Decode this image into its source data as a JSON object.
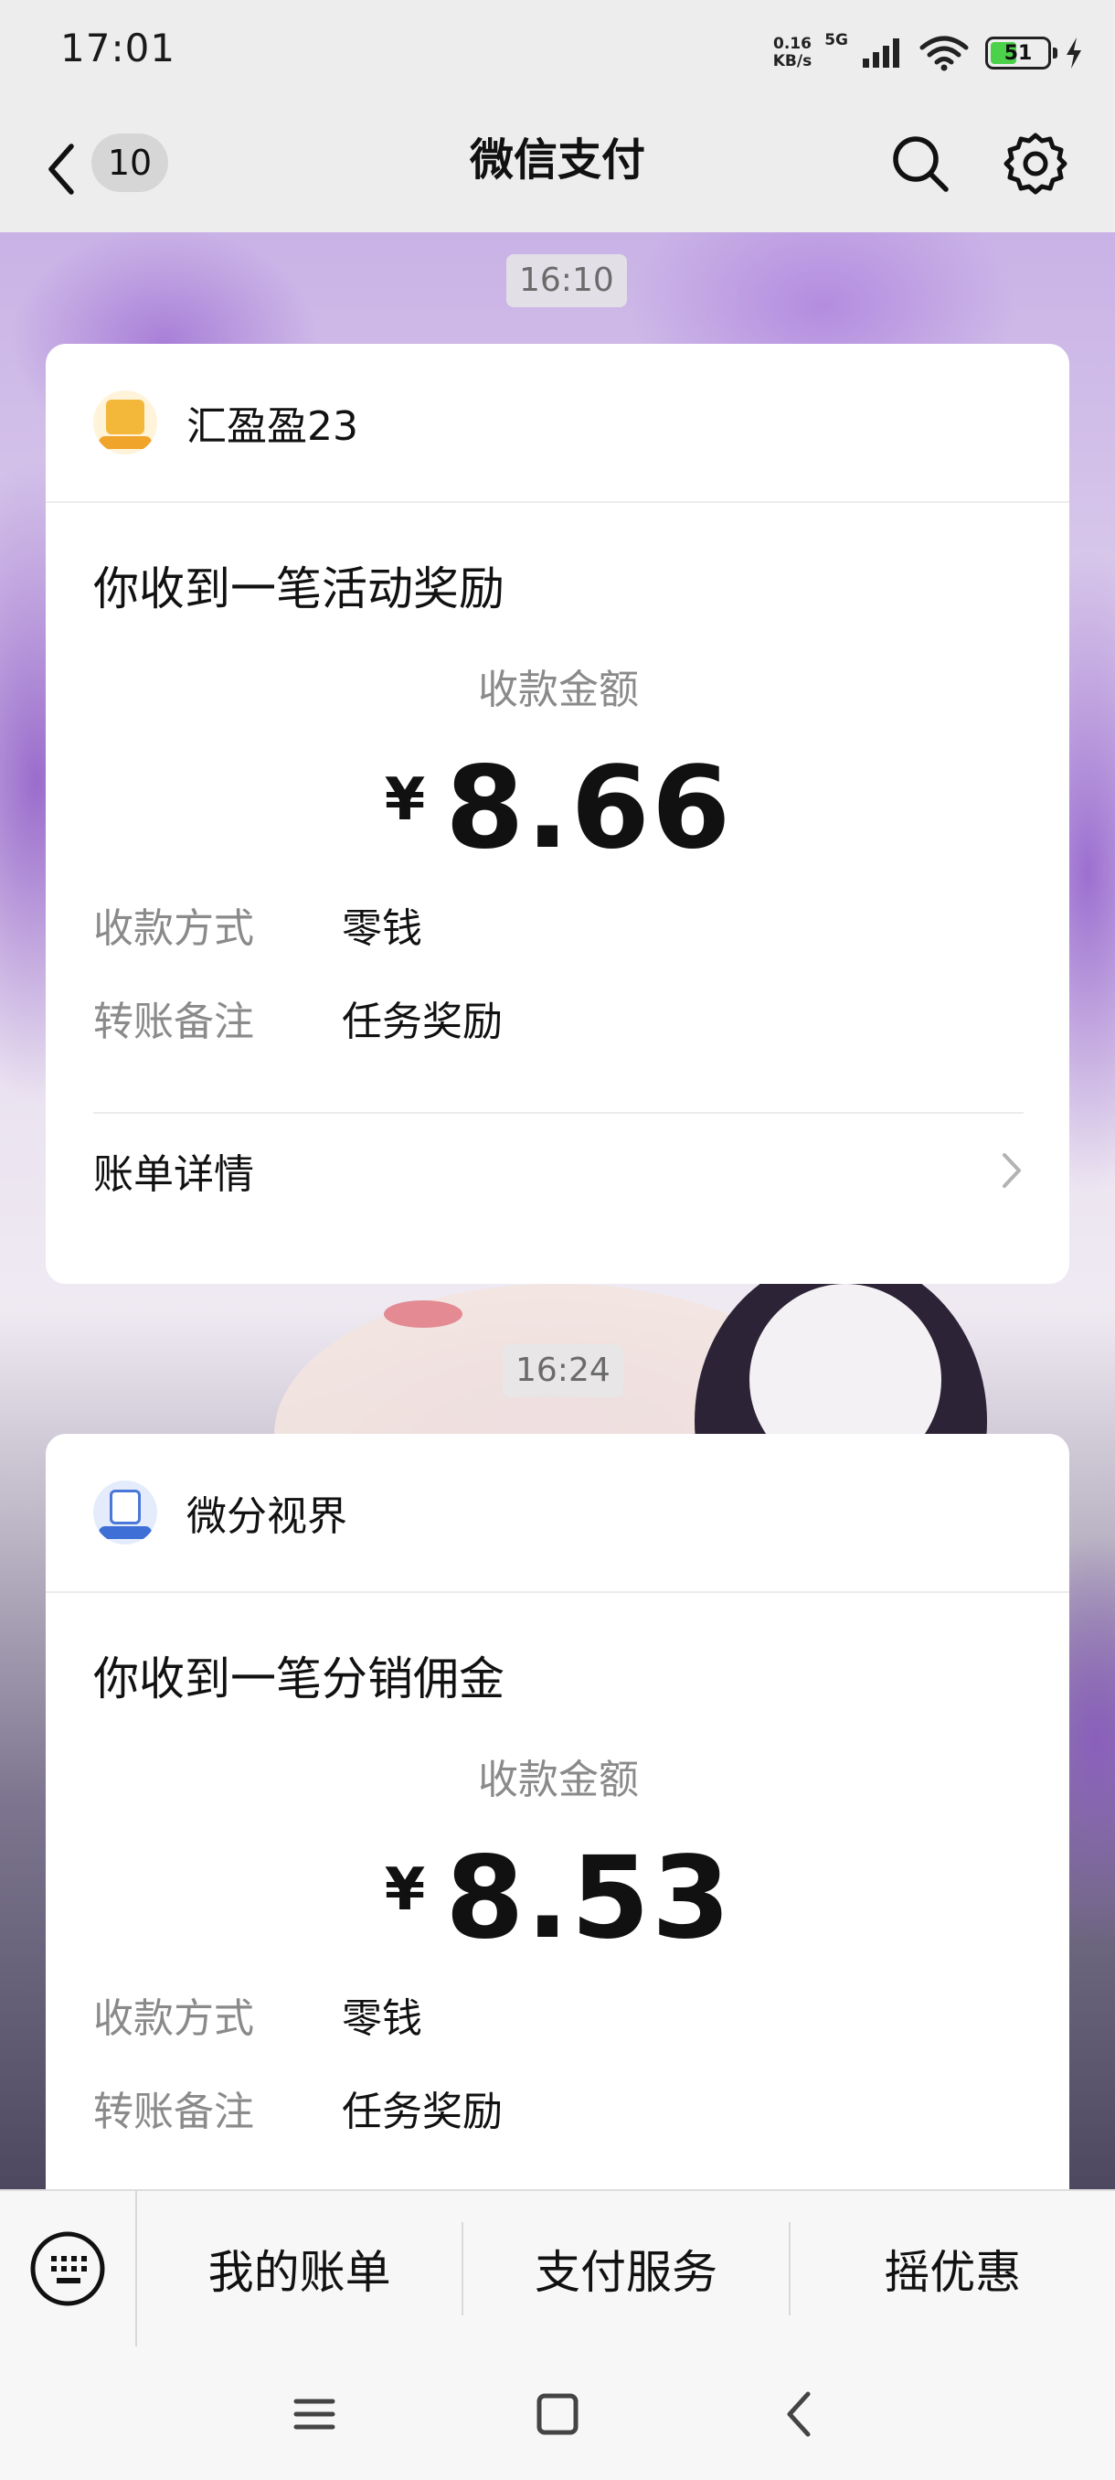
{
  "status_bar": {
    "time": "17:01",
    "net_speed_value": "0.16",
    "net_speed_unit": "KB/s",
    "network_type": "5G",
    "battery_level": "51",
    "battery_fraction": 0.51
  },
  "title_bar": {
    "unread_count": "10",
    "title": "微信支付"
  },
  "messages": [
    {
      "time": "16:10",
      "sender": "汇盈盈23",
      "title": "你收到一笔活动奖励",
      "amount_label": "收款金额",
      "currency": "¥",
      "amount": "8.66",
      "method_label": "收款方式",
      "method": "零钱",
      "note_label": "转账备注",
      "note": "任务奖励",
      "details_label": "账单详情"
    },
    {
      "time": "16:24",
      "sender": "微分视界",
      "title": "你收到一笔分销佣金",
      "amount_label": "收款金额",
      "currency": "¥",
      "amount": "8.53",
      "method_label": "收款方式",
      "method": "零钱",
      "note_label": "转账备注",
      "note": "任务奖励"
    }
  ],
  "bottom_menu": {
    "items": [
      "我的账单",
      "支付服务",
      "摇优惠"
    ]
  },
  "colors": {
    "page_bg": "#ededed",
    "card_bg": "#ffffff",
    "muted_text": "#8a8a8a",
    "battery_green": "#4cd24a"
  }
}
